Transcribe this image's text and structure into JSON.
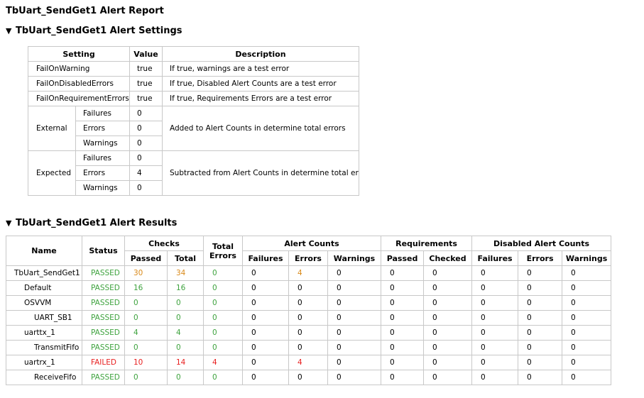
{
  "title": "TbUart_SendGet1 Alert Report",
  "settings_section": {
    "heading": "TbUart_SendGet1 Alert Settings",
    "headers": {
      "setting": "Setting",
      "value": "Value",
      "description": "Description"
    },
    "rows": [
      {
        "setting": "FailOnWarning",
        "value": "true",
        "description": "If true, warnings are a test error"
      },
      {
        "setting": "FailOnDisabledErrors",
        "value": "true",
        "description": "If true, Disabled Alert Counts are a test error"
      },
      {
        "setting": "FailOnRequirementErrors",
        "value": "true",
        "description": "If true, Requirements Errors are a test error"
      }
    ],
    "external": {
      "label": "External",
      "failures_label": "Failures",
      "failures": "0",
      "errors_label": "Errors",
      "errors": "0",
      "warnings_label": "Warnings",
      "warnings": "0",
      "description": "Added to Alert Counts in determine total errors"
    },
    "expected": {
      "label": "Expected",
      "failures_label": "Failures",
      "failures": "0",
      "errors_label": "Errors",
      "errors": "4",
      "warnings_label": "Warnings",
      "warnings": "0",
      "description": "Subtracted from Alert Counts in determine total errors"
    }
  },
  "results_section": {
    "heading": "TbUart_SendGet1 Alert Results",
    "headers": {
      "name": "Name",
      "status": "Status",
      "checks": "Checks",
      "passed": "Passed",
      "total": "Total",
      "total_errors": "Total Errors",
      "alert_counts": "Alert Counts",
      "failures": "Failures",
      "errors": "Errors",
      "warnings": "Warnings",
      "requirements": "Requirements",
      "req_passed": "Passed",
      "req_checked": "Checked",
      "disabled_alert_counts": "Disabled Alert Counts",
      "d_failures": "Failures",
      "d_errors": "Errors",
      "d_warnings": "Warnings"
    },
    "rows": [
      {
        "name": "TbUart_SendGet1",
        "status": "PASSED",
        "passed": "30",
        "total": "34",
        "total_errors": "0",
        "failures": "0",
        "errors": "4",
        "warnings": "0",
        "req_passed": "0",
        "req_checked": "0",
        "d_failures": "0",
        "d_errors": "0",
        "d_warnings": "0"
      },
      {
        "name": "Default",
        "status": "PASSED",
        "passed": "16",
        "total": "16",
        "total_errors": "0",
        "failures": "0",
        "errors": "0",
        "warnings": "0",
        "req_passed": "0",
        "req_checked": "0",
        "d_failures": "0",
        "d_errors": "0",
        "d_warnings": "0"
      },
      {
        "name": "OSVVM",
        "status": "PASSED",
        "passed": "0",
        "total": "0",
        "total_errors": "0",
        "failures": "0",
        "errors": "0",
        "warnings": "0",
        "req_passed": "0",
        "req_checked": "0",
        "d_failures": "0",
        "d_errors": "0",
        "d_warnings": "0"
      },
      {
        "name": "UART_SB1",
        "status": "PASSED",
        "passed": "0",
        "total": "0",
        "total_errors": "0",
        "failures": "0",
        "errors": "0",
        "warnings": "0",
        "req_passed": "0",
        "req_checked": "0",
        "d_failures": "0",
        "d_errors": "0",
        "d_warnings": "0"
      },
      {
        "name": "uarttx_1",
        "status": "PASSED",
        "passed": "4",
        "total": "4",
        "total_errors": "0",
        "failures": "0",
        "errors": "0",
        "warnings": "0",
        "req_passed": "0",
        "req_checked": "0",
        "d_failures": "0",
        "d_errors": "0",
        "d_warnings": "0"
      },
      {
        "name": "TransmitFifo",
        "status": "PASSED",
        "passed": "0",
        "total": "0",
        "total_errors": "0",
        "failures": "0",
        "errors": "0",
        "warnings": "0",
        "req_passed": "0",
        "req_checked": "0",
        "d_failures": "0",
        "d_errors": "0",
        "d_warnings": "0"
      },
      {
        "name": "uartrx_1",
        "status": "FAILED",
        "passed": "10",
        "total": "14",
        "total_errors": "4",
        "failures": "0",
        "errors": "4",
        "warnings": "0",
        "req_passed": "0",
        "req_checked": "0",
        "d_failures": "0",
        "d_errors": "0",
        "d_warnings": "0"
      },
      {
        "name": "ReceiveFifo",
        "status": "PASSED",
        "passed": "0",
        "total": "0",
        "total_errors": "0",
        "failures": "0",
        "errors": "0",
        "warnings": "0",
        "req_passed": "0",
        "req_checked": "0",
        "d_failures": "0",
        "d_errors": "0",
        "d_warnings": "0"
      }
    ]
  },
  "colors": {
    "pass": "#3fa33f",
    "fail": "#e82020",
    "warn": "#d98a1a",
    "border": "#c8c8c8"
  }
}
